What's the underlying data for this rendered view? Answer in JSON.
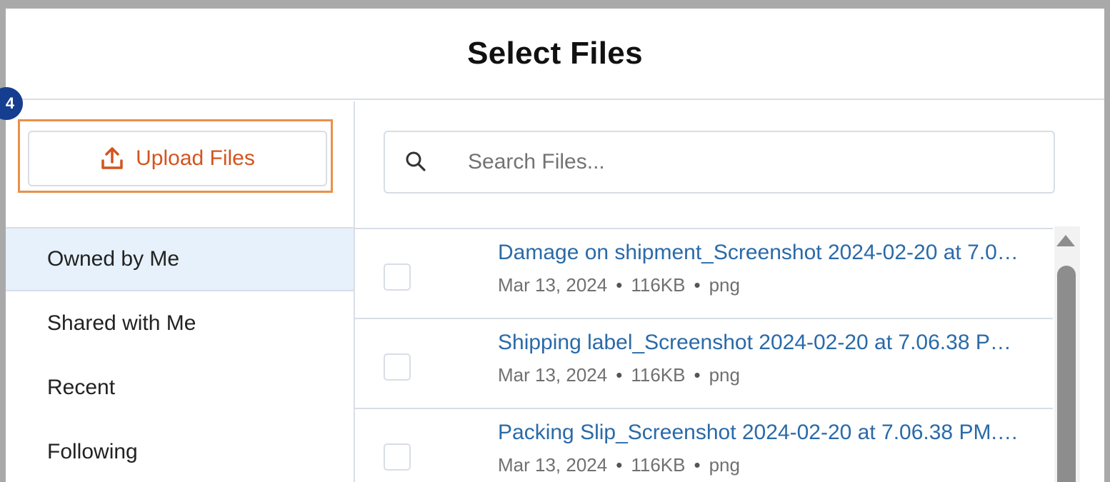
{
  "modal": {
    "title": "Select Files"
  },
  "step_badge": "4",
  "sidebar": {
    "upload_label": "Upload Files",
    "upload_icon": "upload-icon",
    "nav": [
      {
        "label": "Owned by Me",
        "active": true
      },
      {
        "label": "Shared with Me",
        "active": false
      },
      {
        "label": "Recent",
        "active": false
      },
      {
        "label": "Following",
        "active": false
      }
    ]
  },
  "search": {
    "icon": "search-icon",
    "placeholder": "Search Files...",
    "value": ""
  },
  "files": [
    {
      "name": "Damage on shipment_Screenshot 2024-02-20 at 7.0…",
      "date": "Mar 13, 2024",
      "size": "116KB",
      "type": "png"
    },
    {
      "name": "Shipping label_Screenshot 2024-02-20 at 7.06.38 P…",
      "date": "Mar 13, 2024",
      "size": "116KB",
      "type": "png"
    },
    {
      "name": "Packing Slip_Screenshot 2024-02-20 at 7.06.38 PM.…",
      "date": "Mar 13, 2024",
      "size": "116KB",
      "type": "png"
    }
  ],
  "colors": {
    "accent": "#d3541f",
    "link": "#2a6aa8",
    "highlight": "#e8914a",
    "active_bg": "#e6f1fb",
    "badge": "#153e90"
  }
}
